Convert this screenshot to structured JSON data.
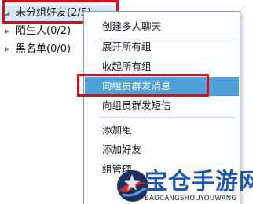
{
  "contacts": {
    "groups": [
      {
        "label": "未分组好友(2/5)",
        "expanded": true,
        "selected": true
      },
      {
        "label": "陌生人(0/2)",
        "expanded": false,
        "selected": false
      },
      {
        "label": "黑名单(0/0)",
        "expanded": false,
        "selected": false
      }
    ]
  },
  "context_menu": {
    "items": [
      {
        "label": "创建多人聊天"
      },
      {
        "label": "展开所有组"
      },
      {
        "label": "收起所有组"
      },
      {
        "label": "向组员群发消息",
        "active": true
      },
      {
        "label": "向组员群发短信"
      },
      {
        "label": "添加组"
      },
      {
        "label": "添加好友"
      },
      {
        "label": "组管理"
      }
    ]
  },
  "watermark": {
    "title": "宝仓手游网",
    "subtitle": "BAOCANGSHOUYOUWANG"
  },
  "colors": {
    "highlight_box": "#d0111b",
    "menu_active": "#4f9fd9",
    "selected_row": "#d6eaf8",
    "watermark_blue": "#1e56b5"
  }
}
